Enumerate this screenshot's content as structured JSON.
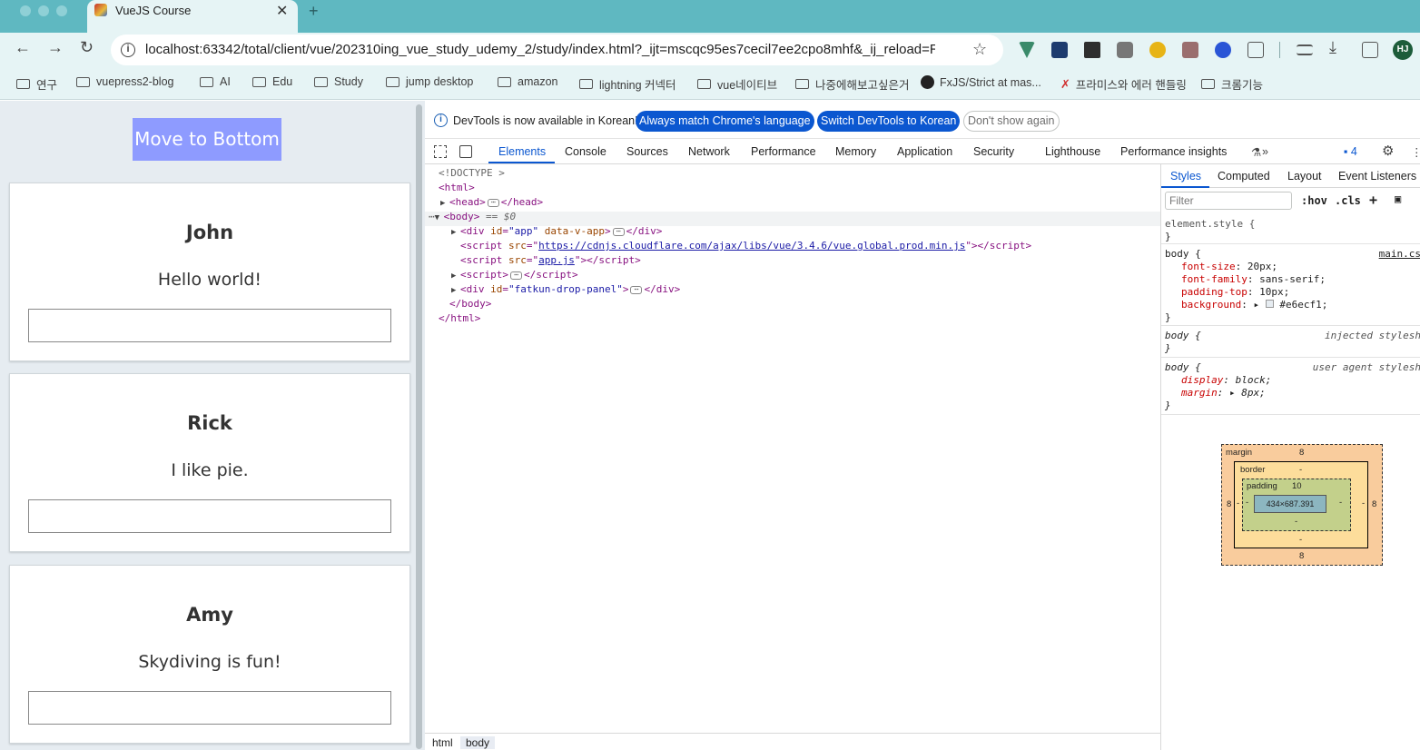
{
  "browser": {
    "tab_title": "VueJS Course",
    "url": "localhost:63342/total/client/vue/202310ing_vue_study_udemy_2/study/index.html?_ijt=mscqc95es7cecil7ee2cpo8mhf&_ij_reload=RE...",
    "profile_initials": "HJ",
    "new_tab_label": "+",
    "close_label": "✕",
    "bookmarks": [
      "연구",
      "vuepress2-blog",
      "AI",
      "Edu",
      "Study",
      "jump desktop",
      "amazon",
      "lightning 커넥터",
      "vue네이티브",
      "나중에해보고싶은거",
      "FxJS/Strict at mas...",
      "프라미스와 에러 핸들링",
      "크롬기능"
    ]
  },
  "page": {
    "move_button": "Move to Bottom",
    "background": "#e6ecf1",
    "button_color": "#8e9bff",
    "cards": [
      {
        "name": "John",
        "message": "Hello world!"
      },
      {
        "name": "Rick",
        "message": "I like pie."
      },
      {
        "name": "Amy",
        "message": "Skydiving is fun!"
      }
    ]
  },
  "devtools": {
    "info_text": "DevTools is now available in Korean!",
    "btn_match": "Always match Chrome's language",
    "btn_switch": "Switch DevTools to Korean",
    "btn_dont": "Don't show again",
    "tabs": [
      "Elements",
      "Console",
      "Sources",
      "Network",
      "Performance",
      "Memory",
      "Application",
      "Security",
      "Lighthouse",
      "Performance insights"
    ],
    "issues_count": "4",
    "dom": {
      "doctype": "<!DOCTYPE >",
      "html_open": "<html>",
      "head_open": "<head>",
      "head_close": "</head>",
      "body_open": "<body>",
      "body_marker": " == $0",
      "app_div_id": "\"app\"",
      "app_div_attr": "data-v-app",
      "script1_src": "https://cdnjs.cloudflare.com/ajax/libs/vue/3.4.6/vue.global.prod.min.js",
      "script2_src": "app.js",
      "fatkun_id": "\"fatkun-drop-panel\"",
      "body_close": "</body>",
      "html_close": "</html>"
    },
    "breadcrumbs": [
      "html",
      "body"
    ],
    "styles_tabs": [
      "Styles",
      "Computed",
      "Layout",
      "Event Listeners"
    ],
    "filter_placeholder": "Filter",
    "hov": ":hov",
    "cls": ".cls",
    "rules": {
      "element_style": "element.style {",
      "close": "}",
      "body_sel": "body {",
      "main_src": "main.cs",
      "props": [
        {
          "name": "font-size",
          "value": "20px;"
        },
        {
          "name": "font-family",
          "value": "sans-serif;"
        },
        {
          "name": "padding-top",
          "value": "10px;"
        },
        {
          "name": "background",
          "value": "#e6ecf1;"
        }
      ],
      "injected": "injected stylesh",
      "user_agent": "user agent stylesh",
      "ua_props": [
        {
          "name": "display",
          "value": "block;"
        },
        {
          "name": "margin",
          "value": "8px;"
        }
      ]
    },
    "box_model": {
      "margin_label": "margin",
      "margin_top": "8",
      "margin_bottom": "8",
      "margin_left": "8",
      "margin_right": "8",
      "border_label": "border",
      "border_top": "-",
      "border_bottom": "-",
      "border_left": "-",
      "border_right": "-",
      "padding_label": "padding",
      "padding_top": "10",
      "padding_bottom": "-",
      "padding_left": "-",
      "padding_right": "-",
      "content": "434×687.391"
    }
  }
}
